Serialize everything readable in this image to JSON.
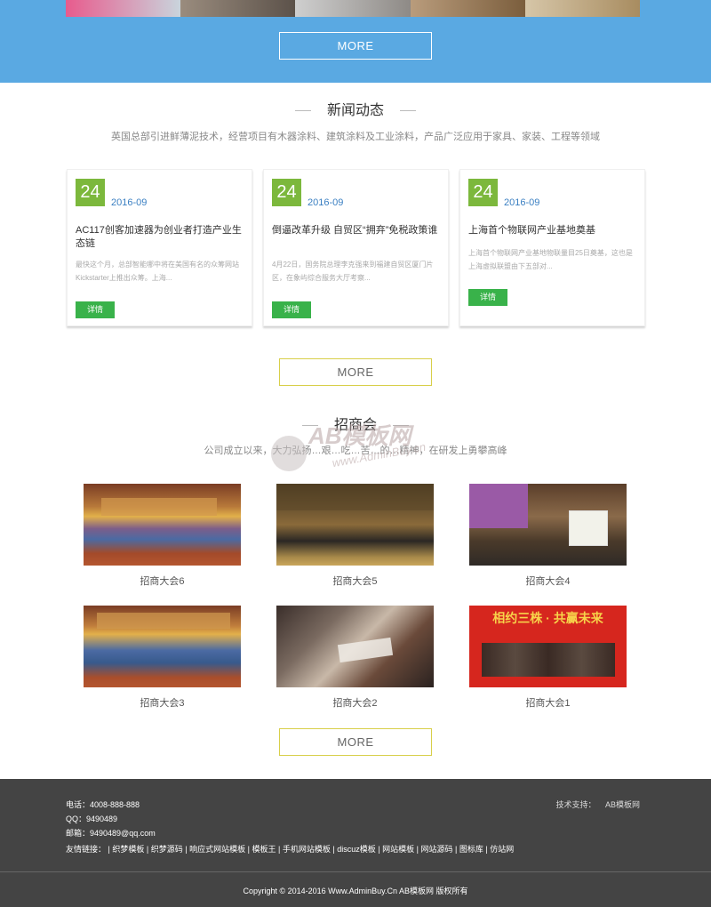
{
  "hero": {
    "more_label": "MORE"
  },
  "news": {
    "title": "新闻动态",
    "subtitle": "英国总部引进鲜薄泥技术，经营项目有木器涂料、建筑涂料及工业涂料，产品广泛应用于家具、家装、工程等领域",
    "items": [
      {
        "day": "24",
        "year_month": "2016-09",
        "title": "AC117创客加速器为创业者打造产业生态链",
        "excerpt": "最快这个月，总部智能哪中将在美国有名的众筹网站Kickstarter上推出众筹。上海...",
        "detail_label": "详情"
      },
      {
        "day": "24",
        "year_month": "2016-09",
        "title": "倒逼改革升级 自贸区“拥弃”免税政策谁",
        "excerpt": "4月22日，国务院总理李克强来到福建自贸区厦门片区，在象屿综合服务大厅考察...",
        "detail_label": "详情"
      },
      {
        "day": "24",
        "year_month": "2016-09",
        "title": "上海首个物联网产业基地奠基",
        "excerpt": "上海首个物联网产业基地物联量目25日奠基，这也是上海虚拟联盟由下五部对...",
        "detail_label": "详情"
      }
    ],
    "more_label": "MORE"
  },
  "investment": {
    "title": "招商会",
    "subtitle": "公司成立以来，大力弘扬…艰…吃…苦…的…精神，在研发上勇攀高峰",
    "items": [
      {
        "caption": "招商大会6"
      },
      {
        "caption": "招商大会5"
      },
      {
        "caption": "招商大会4"
      },
      {
        "caption": "招商大会3"
      },
      {
        "caption": "招商大会2"
      },
      {
        "caption": "招商大会1"
      }
    ],
    "more_label": "MORE",
    "banner_text": "相约三株 · 共赢未来"
  },
  "watermark": {
    "brand": "AB模板网",
    "url": "www.AdminBuy.cn"
  },
  "footer": {
    "phone_label": "电话：",
    "phone": "4008-888-888",
    "qq_label": "QQ：",
    "qq": "9490489",
    "email_label": "邮箱：",
    "email": "9490489@qq.com",
    "links_label": "友情链接：",
    "links": [
      "织梦模板",
      "织梦源码",
      "响应式网站模板",
      "模板王",
      "手机网站模板",
      "discuz模板",
      "网站模板",
      "网站源码",
      "图标库",
      "仿站网"
    ],
    "tech_label": "技术支持：",
    "tech_value": "AB模板网",
    "copyright": "Copyright © 2014-2016 Www.AdminBuy.Cn AB模板网 版权所有"
  },
  "colors": {
    "top_band": "#5aa9e2",
    "date_box": "#7cb83c",
    "detail_button": "#39b24a",
    "footer_bg": "#444444",
    "more_border": "#d8cf4a"
  }
}
